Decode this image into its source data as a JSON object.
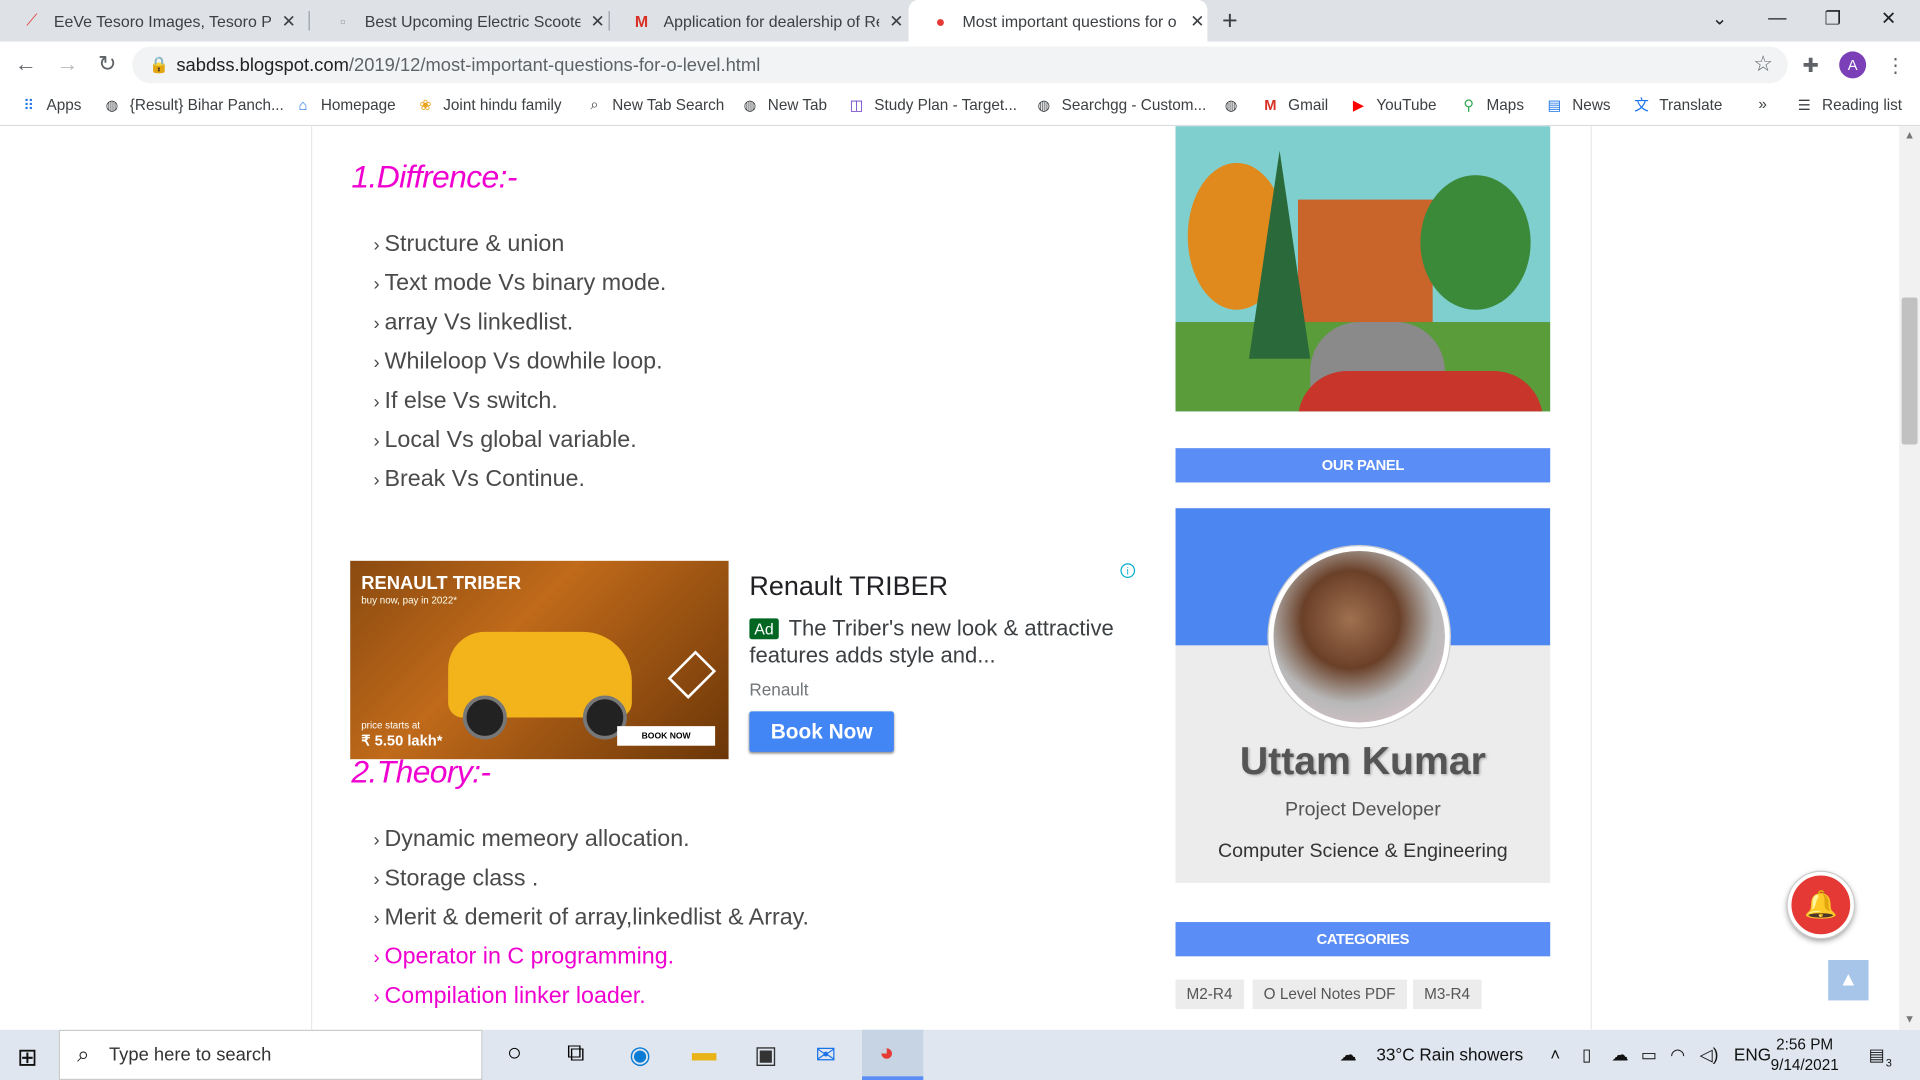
{
  "browser": {
    "tabs": [
      {
        "title": "EeVe Tesoro Images, Tesoro Phot",
        "active": false
      },
      {
        "title": "Best Upcoming Electric Scooters",
        "active": false
      },
      {
        "title": "Application for dealership of Rev",
        "active": false
      },
      {
        "title": "Most important questions for o le",
        "active": true
      }
    ],
    "url_host": "sabdss.blogspot.com",
    "url_path": "/2019/12/most-important-questions-for-o-level.html",
    "profile_initial": "A",
    "bookmarks": [
      {
        "label": "Apps",
        "icon": "apps-grid-icon"
      },
      {
        "label": "{Result} Bihar Panch...",
        "icon": "globe-icon"
      },
      {
        "label": "Homepage",
        "icon": "home-icon"
      },
      {
        "label": "Joint hindu family",
        "icon": "bookmark-icon"
      },
      {
        "label": "New Tab Search",
        "icon": "search-icon"
      },
      {
        "label": "New Tab",
        "icon": "globe-icon"
      },
      {
        "label": "Study Plan - Target...",
        "icon": "bookmark-icon"
      },
      {
        "label": "Searchgg - Custom...",
        "icon": "globe-icon"
      },
      {
        "label": "",
        "icon": "globe-icon"
      },
      {
        "label": "Gmail",
        "icon": "gmail-icon"
      },
      {
        "label": "YouTube",
        "icon": "youtube-icon"
      },
      {
        "label": "Maps",
        "icon": "maps-icon"
      },
      {
        "label": "News",
        "icon": "news-icon"
      },
      {
        "label": "Translate",
        "icon": "translate-icon"
      }
    ],
    "bookmarks_more": "»",
    "reading_list": "Reading list"
  },
  "article": {
    "section1_heading": "1.Diffrence:-",
    "section1_items": [
      "Structure & union",
      "Text mode Vs binary mode.",
      "array Vs linkedlist.",
      "Whileloop Vs dowhile loop.",
      "If else Vs switch.",
      "Local Vs global variable.",
      "Break Vs Continue."
    ],
    "section2_heading": "2.Theory:-",
    "section2_items": [
      {
        "text": "Dynamic memeory allocation.",
        "link": false
      },
      {
        "text": "Storage class .",
        "link": false
      },
      {
        "text": "Merit & demerit of array,linkedlist & Array.",
        "link": false
      },
      {
        "text": "Operator in C programming.",
        "link": true
      },
      {
        "text": "Compilation linker loader.",
        "link": true
      }
    ]
  },
  "ad": {
    "image_brand": "RENAULT TRIBER",
    "image_tagline": "buy now, pay in 2022*",
    "image_price_label": "price starts at",
    "image_price": "₹ 5.50 lakh*",
    "image_cta": "BOOK NOW",
    "title": "Renault TRIBER",
    "badge": "Ad",
    "description": "The Triber's new look & attractive features adds style and...",
    "source": "Renault",
    "button": "Book Now"
  },
  "sidebar": {
    "panel_header": "OUR PANEL",
    "name": "Uttam Kumar",
    "role": "Project Developer",
    "dept": "Computer Science & Engineering",
    "categories_header": "CATEGORIES",
    "categories": [
      "M2-R4",
      "O Level Notes PDF",
      "M3-R4"
    ]
  },
  "taskbar": {
    "search_placeholder": "Type here to search",
    "weather": "33°C  Rain showers",
    "language": "ENG",
    "time": "2:56 PM",
    "date": "9/14/2021",
    "notifications": "3"
  },
  "colors": {
    "accent": "#5a8df5",
    "heading_pink": "#f000d0",
    "ad_button": "#4285f4"
  }
}
